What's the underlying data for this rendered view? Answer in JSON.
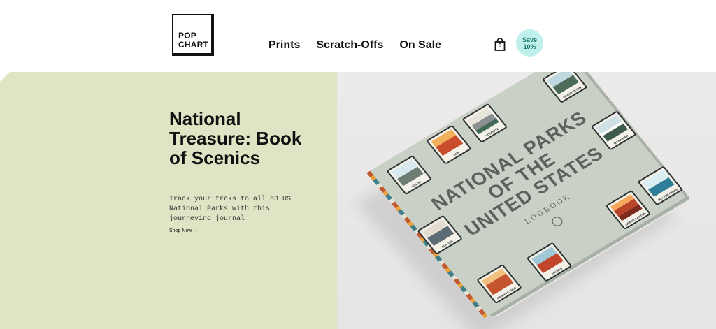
{
  "brand": {
    "logo_line1": "POP",
    "logo_line2": "CHART"
  },
  "nav": {
    "items": [
      {
        "label": "Prints"
      },
      {
        "label": "Scratch-Offs"
      },
      {
        "label": "On Sale"
      }
    ]
  },
  "cart": {
    "count": "0",
    "icon": "shopping-bag-icon"
  },
  "promo": {
    "line1": "Save",
    "line2": "10%",
    "color": "#bff0ec"
  },
  "hero": {
    "title": "National Treasure: Book of Scenics",
    "subtitle": "Track your treks to all 63 US National Parks with this journeying journal",
    "cta": "Shop Now →",
    "bg_color": "#dfe5c4"
  },
  "book": {
    "title_line1": "NATIONAL PARKS",
    "title_line2": "OF THE",
    "title_line3": "UNITED STATES",
    "subtitle": "LOGBOOK",
    "stamps": [
      {
        "caption": "ACADIA"
      },
      {
        "caption": "ZION"
      },
      {
        "caption": "YOSEMITE"
      },
      {
        "caption": "GRAND TETON"
      },
      {
        "caption": "GLACIER"
      },
      {
        "caption": "MT RAINIER"
      },
      {
        "caption": "CANYONLANDS"
      },
      {
        "caption": "ARCHES"
      },
      {
        "caption": "GRAND CANYON"
      },
      {
        "caption": "DRY TORTUGAS"
      }
    ]
  }
}
